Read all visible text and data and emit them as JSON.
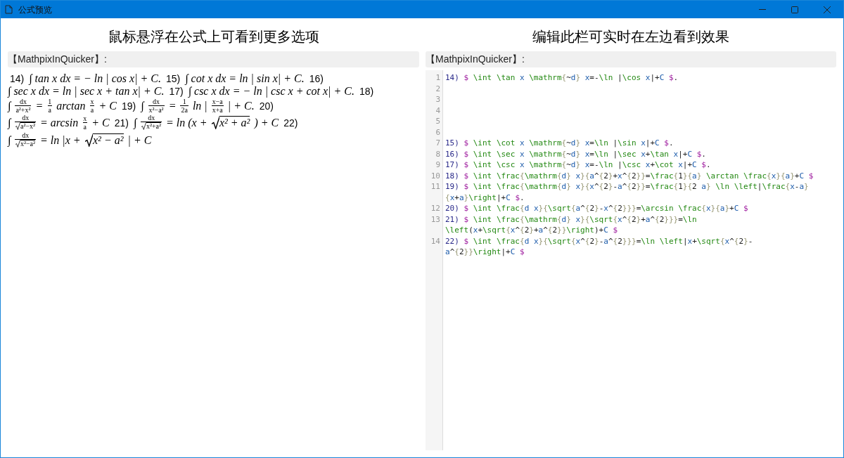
{
  "window": {
    "title": "公式预览"
  },
  "preview": {
    "heading": "鼠标悬浮在公式上可看到更多选项",
    "label": "【MathpixInQuicker】:",
    "lines": [
      [
        {
          "kind": "label",
          "text": "14)"
        },
        {
          "kind": "math",
          "text": "∫ tan x dx = − ln | cos x| + C."
        },
        {
          "kind": "label",
          "text": "15)"
        },
        {
          "kind": "math",
          "text": "∫ cot x dx = ln | sin x| + C."
        },
        {
          "kind": "label",
          "text": "16)"
        }
      ],
      [
        {
          "kind": "math",
          "text": "∫ sec x dx = ln | sec x + tan x| + C."
        },
        {
          "kind": "label",
          "text": "17)"
        },
        {
          "kind": "math",
          "text": "∫ csc x dx = − ln | csc x + cot x| + C."
        },
        {
          "kind": "label",
          "text": "18)"
        }
      ],
      [
        {
          "kind": "math",
          "text": "∫"
        },
        {
          "kind": "frac",
          "num": "dx",
          "den": "a²+x²",
          "root": false
        },
        {
          "kind": "math",
          "text": "="
        },
        {
          "kind": "frac",
          "num": "1",
          "den": "a",
          "root": false
        },
        {
          "kind": "math",
          "text": "arctan"
        },
        {
          "kind": "frac",
          "num": "x",
          "den": "a",
          "root": false
        },
        {
          "kind": "math",
          "text": "+ C"
        },
        {
          "kind": "label",
          "text": "19)"
        },
        {
          "kind": "math",
          "text": "∫"
        },
        {
          "kind": "frac",
          "num": "dx",
          "den": "x²−a²",
          "root": false
        },
        {
          "kind": "math",
          "text": "="
        },
        {
          "kind": "frac",
          "num": "1",
          "den": "2a",
          "root": false
        },
        {
          "kind": "math",
          "text": "ln |"
        },
        {
          "kind": "frac",
          "num": "x−a",
          "den": "x+a",
          "root": false
        },
        {
          "kind": "math",
          "text": "| + C."
        },
        {
          "kind": "label",
          "text": "20)"
        }
      ],
      [
        {
          "kind": "math",
          "text": "∫"
        },
        {
          "kind": "frac",
          "num": "dx",
          "den": "a²−x²",
          "root": true
        },
        {
          "kind": "math",
          "text": "= arcsin"
        },
        {
          "kind": "frac",
          "num": "x",
          "den": "a",
          "root": false
        },
        {
          "kind": "math",
          "text": "+ C"
        },
        {
          "kind": "label",
          "text": "21)"
        },
        {
          "kind": "math",
          "text": "∫"
        },
        {
          "kind": "frac",
          "num": "dx",
          "den": "x²+a²",
          "root": true
        },
        {
          "kind": "math",
          "text": "= ln (x +"
        },
        {
          "kind": "root",
          "text": "x² + a²"
        },
        {
          "kind": "math",
          "text": ") + C"
        },
        {
          "kind": "label",
          "text": "22)"
        }
      ],
      [
        {
          "kind": "math",
          "text": "∫"
        },
        {
          "kind": "frac",
          "num": "dx",
          "den": "x²−a²",
          "root": true
        },
        {
          "kind": "math",
          "text": "= ln |x +"
        },
        {
          "kind": "root",
          "text": "x² − a²"
        },
        {
          "kind": "math",
          "text": "| + C"
        }
      ]
    ]
  },
  "editor": {
    "heading": "编辑此栏可实时在左边看到效果",
    "label": "【MathpixInQuicker】:",
    "lines": [
      {
        "number": "1",
        "rows": [
          "14) $ \\int \\tan x \\mathrm{~d} x=-\\ln |\\cos x|+C $."
        ]
      },
      {
        "number": "2"
      },
      {
        "number": "3"
      },
      {
        "number": "4"
      },
      {
        "number": "5"
      },
      {
        "number": "6"
      },
      {
        "number": "7",
        "rows": [
          "15) $ \\int \\cot x \\mathrm{~d} x=\\ln |\\sin x|+C $."
        ]
      },
      {
        "number": "8",
        "rows": [
          "16) $ \\int \\sec x \\mathrm{~d} x=\\ln |\\sec x+\\tan x|+C $."
        ]
      },
      {
        "number": "9",
        "rows": [
          "17) $ \\int \\csc x \\mathrm{~d} x=-\\ln |\\csc x+\\cot x|+C $."
        ]
      },
      {
        "number": "10",
        "rows": [
          "18) $ \\int \\frac{\\mathrm{d} x}{a^{2}+x^{2}}=\\frac{1}{a} \\arctan \\frac{x}{a}+C $"
        ]
      },
      {
        "number": "11",
        "rows": [
          "19) $ \\int \\frac{\\mathrm{d} x}{x^{2}-a^{2}}=\\frac{1}{2 a} \\ln \\left|\\frac{x-a}",
          "{x+a}\\right|+C $."
        ]
      },
      {
        "number": "12",
        "rows": [
          "20) $ \\int \\frac{d x}{\\sqrt{a^{2}-x^{2}}}=\\arcsin \\frac{x}{a}+C $"
        ]
      },
      {
        "number": "13",
        "rows": [
          "21) $ \\int \\frac{\\mathrm{d} x}{\\sqrt{x^{2}+a^{2}}}=\\ln",
          "\\left(x+\\sqrt{x^{2}+a^{2}}\\right)+C $"
        ]
      },
      {
        "number": "14",
        "rows": [
          "22) $ \\int \\frac{d x}{\\sqrt{x^{2}-a^{2}}}=\\ln \\left|x+\\sqrt{x^{2}-",
          "a^{2}}\\right|+C $"
        ]
      }
    ]
  }
}
